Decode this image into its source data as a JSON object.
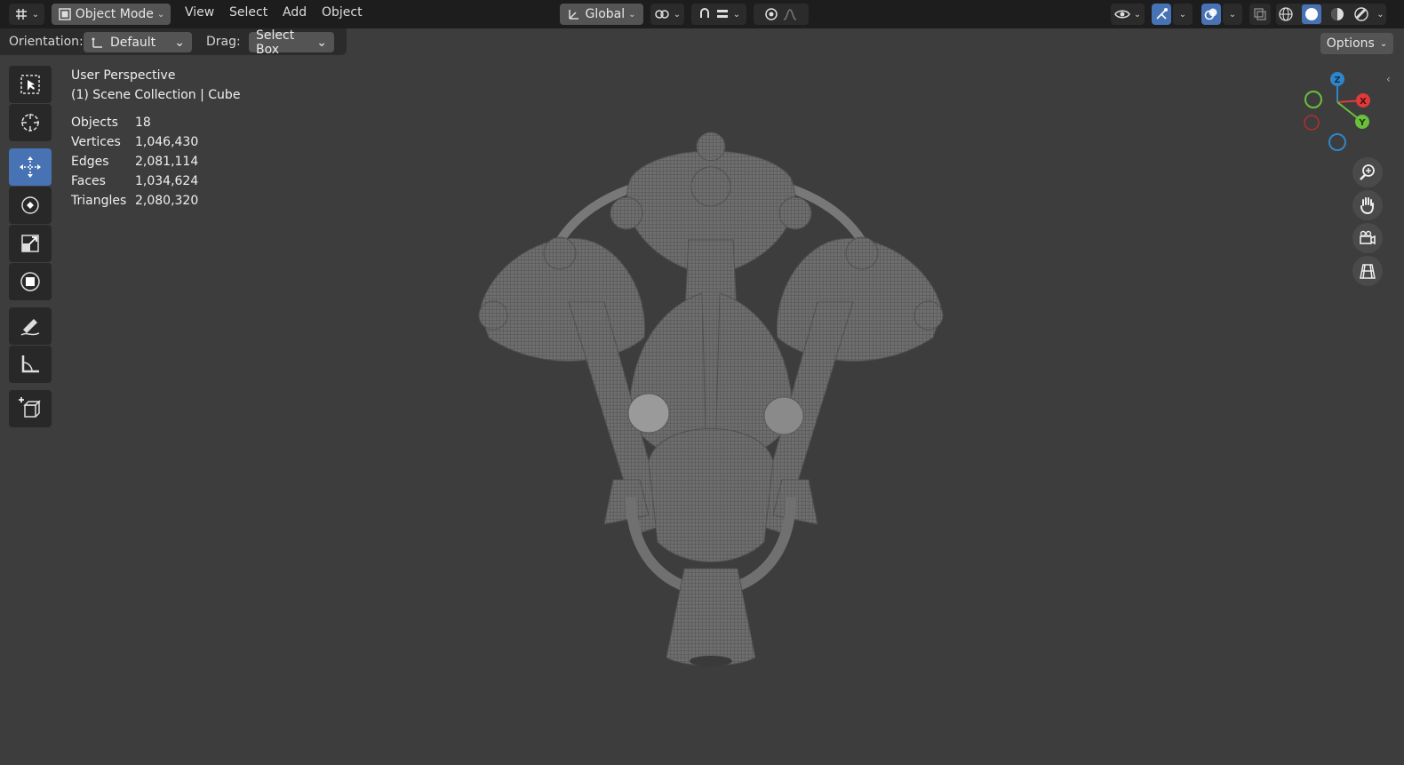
{
  "top_bar": {
    "editor_type_icon": "3d-viewport-icon",
    "mode": {
      "icon": "object-mode-icon",
      "label": "Object Mode"
    },
    "menus": [
      "View",
      "Select",
      "Add",
      "Object"
    ],
    "transform_orientation": {
      "icon": "global-orientation-icon",
      "label": "Global"
    },
    "icons": [
      "pivot-icon",
      "snap-icon",
      "snap-increment-icon",
      "proportional-edit-icon",
      "falloff-icon",
      "visibility-icon",
      "gizmo-icon",
      "overlay-icon",
      "xray-icon",
      "wireframe-shading-icon",
      "solid-shading-icon",
      "material-shading-icon",
      "rendered-shading-icon"
    ]
  },
  "header": {
    "orientation_label": "Orientation:",
    "orientation_value": "Default",
    "drag_label": "Drag:",
    "drag_value": "Select Box",
    "options_label": "Options"
  },
  "tools": [
    {
      "name": "select-box-tool",
      "active": false
    },
    {
      "name": "cursor-tool",
      "active": false
    },
    {
      "name": "move-tool",
      "active": true
    },
    {
      "name": "rotate-tool",
      "active": false
    },
    {
      "name": "scale-tool",
      "active": false
    },
    {
      "name": "transform-tool",
      "active": false
    },
    {
      "name": "annotate-tool",
      "active": false
    },
    {
      "name": "measure-tool",
      "active": false
    },
    {
      "name": "add-cube-tool",
      "active": false
    }
  ],
  "viewport": {
    "perspective": "User Perspective",
    "collection": "(1) Scene Collection | Cube",
    "stats": [
      {
        "label": "Objects",
        "value": "18"
      },
      {
        "label": "Vertices",
        "value": "1,046,430"
      },
      {
        "label": "Edges",
        "value": "2,081,114"
      },
      {
        "label": "Faces",
        "value": "1,034,624"
      },
      {
        "label": "Triangles",
        "value": "2,080,320"
      }
    ]
  },
  "gizmo": {
    "x": "X",
    "y": "Y",
    "z": "Z"
  },
  "nav_icons": [
    "zoom-icon",
    "pan-hand-icon",
    "camera-view-icon",
    "orthographic-grid-icon"
  ],
  "colors": {
    "active_tool": "#4772b3",
    "axis_x": "#e03a3a",
    "axis_y": "#6bbf3a",
    "axis_z": "#2f86c9"
  }
}
